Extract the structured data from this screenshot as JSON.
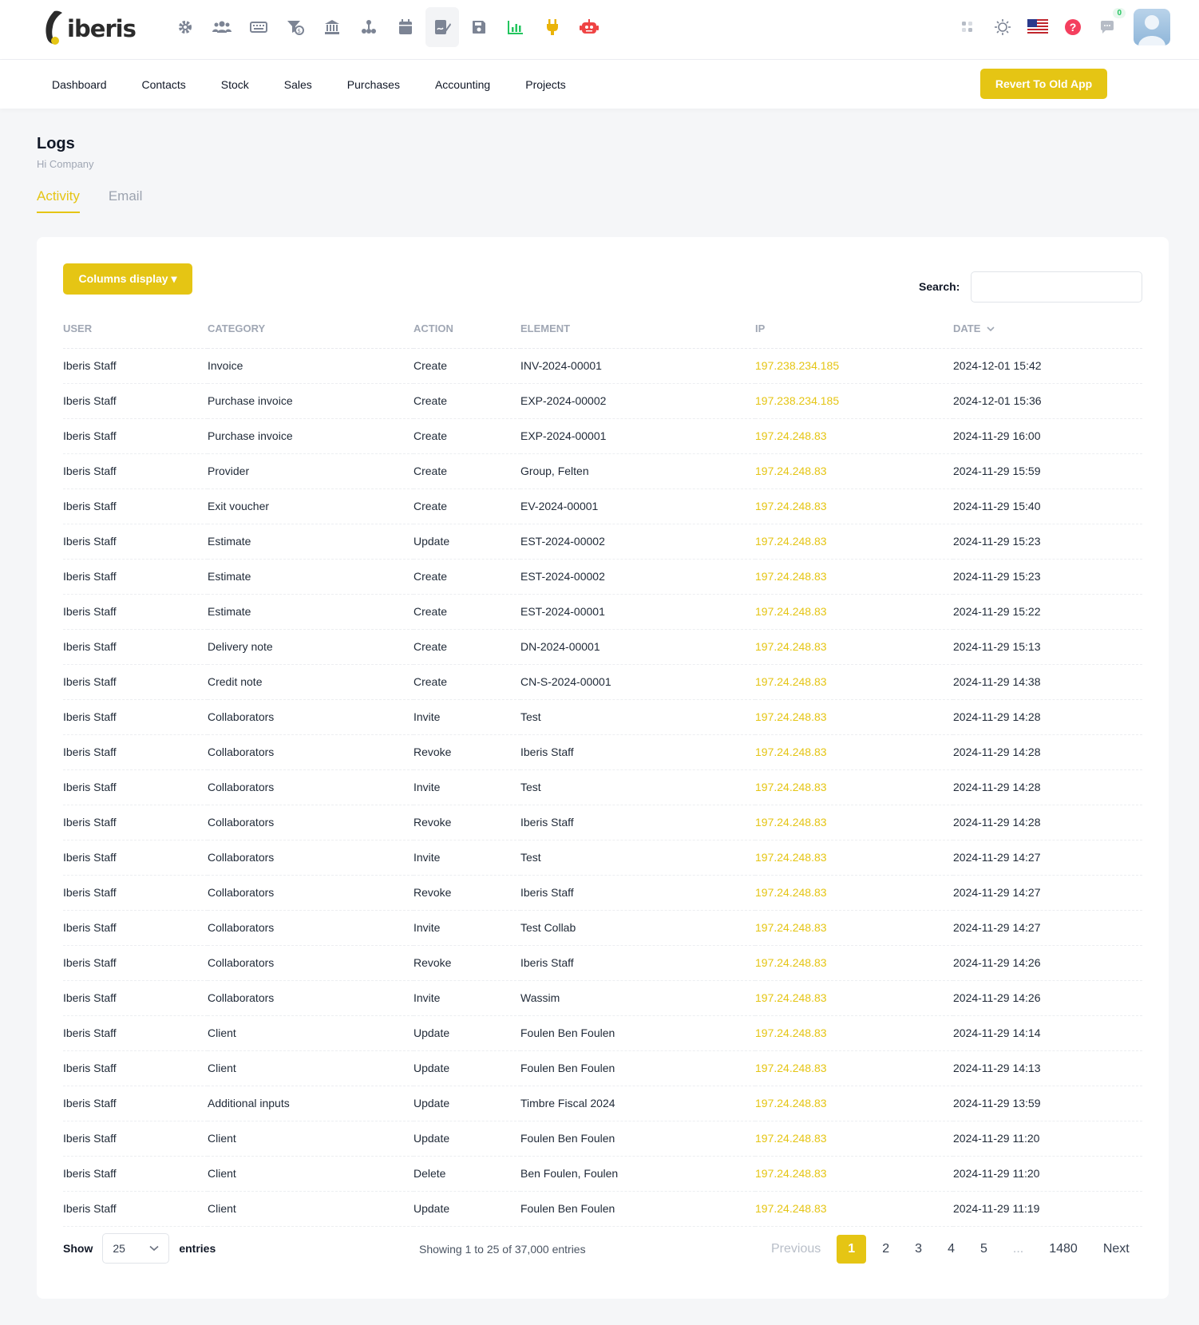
{
  "brand": {
    "name": "iberis"
  },
  "module_icons": [
    "settings-icon",
    "users-icon",
    "keyboard-icon",
    "filter-dollar-icon",
    "bank-icon",
    "hierarchy-icon",
    "calendar-icon",
    "signature-icon",
    "save-disk-icon",
    "bar-chart-icon",
    "plug-icon",
    "robot-icon"
  ],
  "right_icons": [
    "apps-icon",
    "theme-sun-icon",
    "us-flag-icon",
    "help-icon",
    "chat-icon"
  ],
  "notifications_count": "0",
  "nav": {
    "items": [
      "Dashboard",
      "Contacts",
      "Stock",
      "Sales",
      "Purchases",
      "Accounting",
      "Projects"
    ],
    "revert_label": "Revert To Old App"
  },
  "page": {
    "title": "Logs",
    "subtitle": "Hi Company",
    "tabs": [
      {
        "label": "Activity",
        "active": true
      },
      {
        "label": "Email",
        "active": false
      }
    ]
  },
  "toolbar": {
    "columns_display_label": "Columns display ▾",
    "search_label": "Search:",
    "search_value": ""
  },
  "table": {
    "columns": [
      "USER",
      "CATEGORY",
      "ACTION",
      "ELEMENT",
      "IP",
      "DATE"
    ],
    "sort_column": "DATE",
    "rows": [
      [
        "Iberis Staff",
        "Invoice",
        "Create",
        "INV-2024-00001",
        "197.238.234.185",
        "2024-12-01 15:42"
      ],
      [
        "Iberis Staff",
        "Purchase invoice",
        "Create",
        "EXP-2024-00002",
        "197.238.234.185",
        "2024-12-01 15:36"
      ],
      [
        "Iberis Staff",
        "Purchase invoice",
        "Create",
        "EXP-2024-00001",
        "197.24.248.83",
        "2024-11-29 16:00"
      ],
      [
        "Iberis Staff",
        "Provider",
        "Create",
        "Group, Felten",
        "197.24.248.83",
        "2024-11-29 15:59"
      ],
      [
        "Iberis Staff",
        "Exit voucher",
        "Create",
        "EV-2024-00001",
        "197.24.248.83",
        "2024-11-29 15:40"
      ],
      [
        "Iberis Staff",
        "Estimate",
        "Update",
        "EST-2024-00002",
        "197.24.248.83",
        "2024-11-29 15:23"
      ],
      [
        "Iberis Staff",
        "Estimate",
        "Create",
        "EST-2024-00002",
        "197.24.248.83",
        "2024-11-29 15:23"
      ],
      [
        "Iberis Staff",
        "Estimate",
        "Create",
        "EST-2024-00001",
        "197.24.248.83",
        "2024-11-29 15:22"
      ],
      [
        "Iberis Staff",
        "Delivery note",
        "Create",
        "DN-2024-00001",
        "197.24.248.83",
        "2024-11-29 15:13"
      ],
      [
        "Iberis Staff",
        "Credit note",
        "Create",
        "CN-S-2024-00001",
        "197.24.248.83",
        "2024-11-29 14:38"
      ],
      [
        "Iberis Staff",
        "Collaborators",
        "Invite",
        "Test",
        "197.24.248.83",
        "2024-11-29 14:28"
      ],
      [
        "Iberis Staff",
        "Collaborators",
        "Revoke",
        "Iberis Staff",
        "197.24.248.83",
        "2024-11-29 14:28"
      ],
      [
        "Iberis Staff",
        "Collaborators",
        "Invite",
        "Test",
        "197.24.248.83",
        "2024-11-29 14:28"
      ],
      [
        "Iberis Staff",
        "Collaborators",
        "Revoke",
        "Iberis Staff",
        "197.24.248.83",
        "2024-11-29 14:28"
      ],
      [
        "Iberis Staff",
        "Collaborators",
        "Invite",
        "Test",
        "197.24.248.83",
        "2024-11-29 14:27"
      ],
      [
        "Iberis Staff",
        "Collaborators",
        "Revoke",
        "Iberis Staff",
        "197.24.248.83",
        "2024-11-29 14:27"
      ],
      [
        "Iberis Staff",
        "Collaborators",
        "Invite",
        "Test Collab",
        "197.24.248.83",
        "2024-11-29 14:27"
      ],
      [
        "Iberis Staff",
        "Collaborators",
        "Revoke",
        "Iberis Staff",
        "197.24.248.83",
        "2024-11-29 14:26"
      ],
      [
        "Iberis Staff",
        "Collaborators",
        "Invite",
        "Wassim",
        "197.24.248.83",
        "2024-11-29 14:26"
      ],
      [
        "Iberis Staff",
        "Client",
        "Update",
        "Foulen Ben Foulen",
        "197.24.248.83",
        "2024-11-29 14:14"
      ],
      [
        "Iberis Staff",
        "Client",
        "Update",
        "Foulen Ben Foulen",
        "197.24.248.83",
        "2024-11-29 14:13"
      ],
      [
        "Iberis Staff",
        "Additional inputs",
        "Update",
        "Timbre Fiscal 2024",
        "197.24.248.83",
        "2024-11-29 13:59"
      ],
      [
        "Iberis Staff",
        "Client",
        "Update",
        "Foulen Ben Foulen",
        "197.24.248.83",
        "2024-11-29 11:20"
      ],
      [
        "Iberis Staff",
        "Client",
        "Delete",
        "Ben Foulen, Foulen",
        "197.24.248.83",
        "2024-11-29 11:20"
      ],
      [
        "Iberis Staff",
        "Client",
        "Update",
        "Foulen Ben Foulen",
        "197.24.248.83",
        "2024-11-29 11:19"
      ]
    ]
  },
  "footer": {
    "show_label": "Show",
    "page_length": "25",
    "entries_label": "entries",
    "info": "Showing 1 to 25 of 37,000 entries",
    "pagination": {
      "previous": "Previous",
      "pages": [
        "1",
        "2",
        "3",
        "4",
        "5"
      ],
      "ellipsis": "...",
      "last": "1480",
      "next": "Next",
      "current": "1"
    }
  },
  "colors": {
    "accent": "#e5c514",
    "muted": "#a0a7b4",
    "text": "#1f2937"
  }
}
